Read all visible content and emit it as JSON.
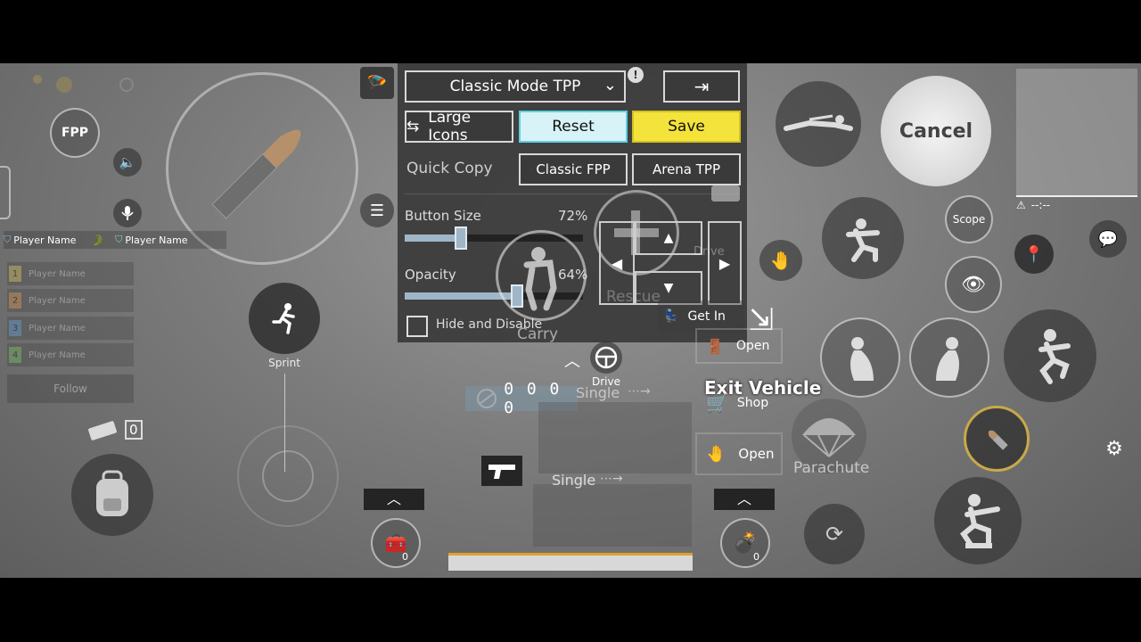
{
  "topbar": {
    "mode_label": "Classic Mode TPP",
    "large_icons_label": "Large Icons",
    "reset_label": "Reset",
    "save_label": "Save",
    "quick_copy_label": "Quick Copy",
    "classic_fpp_label": "Classic FPP",
    "arena_tpp_label": "Arena TPP"
  },
  "settings": {
    "button_size_label": "Button Size",
    "button_size_value": "72%",
    "button_size_fraction": 0.72,
    "opacity_label": "Opacity",
    "opacity_value": "64%",
    "opacity_fraction": 0.64,
    "hide_disable_label": "Hide and Disable"
  },
  "left": {
    "fpp_label": "FPP",
    "player1": "Player Name",
    "player2": "Player Name",
    "team": [
      {
        "num": "1",
        "name": "Player Name",
        "color": "#d8c26a"
      },
      {
        "num": "2",
        "name": "Player Name",
        "color": "#d99a5a"
      },
      {
        "num": "3",
        "name": "Player Name",
        "color": "#6a9fd8"
      },
      {
        "num": "4",
        "name": "Player Name",
        "color": "#7fc06a"
      }
    ],
    "follow_label": "Follow",
    "sprint_label": "Sprint",
    "throwable_count": "0"
  },
  "center": {
    "carry_label": "Carry",
    "rescue_label": "Rescue",
    "drive_label": "Drive",
    "drive_top_label": "Drive",
    "get_in_label": "Get In",
    "open_label_1": "Open",
    "exit_vehicle_label": "Exit Vehicle",
    "shop_label": "Shop",
    "open_label_2": "Open",
    "single_label_1": "Single",
    "single_label_2": "Single",
    "ammo_digits": "0 0 0 0",
    "heal_count": "0",
    "grenade_count": "0"
  },
  "right": {
    "cancel_label": "Cancel",
    "scope_label": "Scope",
    "parachute_label": "Parachute",
    "network_label": "--:--"
  },
  "colors": {
    "reset_bg": "#d7f3f7",
    "save_bg": "#f4e33a",
    "panel_bg": "#3a3a3a"
  }
}
